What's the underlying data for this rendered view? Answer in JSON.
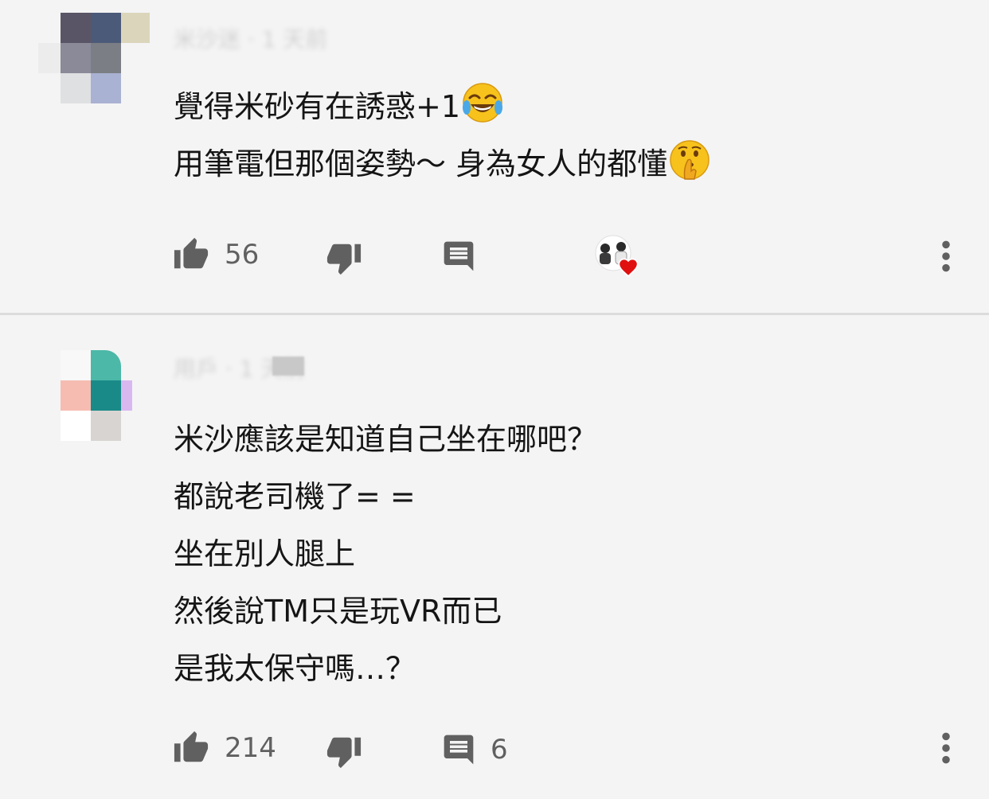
{
  "comments": [
    {
      "author_blurred": "米沙迷 · 1 天前",
      "lines": [
        "覺得米砂有在誘惑+1",
        "用筆電但那個姿勢～ 身為女人的都懂"
      ],
      "line_emojis": [
        "face-with-tears-of-joy-emoji",
        "shushing-face-emoji"
      ],
      "likes": "56",
      "replies": "",
      "hearted_by_creator": true,
      "avatar_colors": [
        "#5a5566",
        "#4c5a7a",
        "#c9bf94",
        "#8a8a99",
        "#7b7e84",
        "#dfe0e2",
        "#a9b2d2"
      ]
    },
    {
      "author_blurred": "用戶 · 1 天前",
      "lines": [
        "米沙應該是知道自己坐在哪吧？",
        "都說老司機了= =",
        "坐在別人腿上",
        "然後說TM只是玩VR而已",
        "是我太保守嗎…？"
      ],
      "likes": "214",
      "replies": "6",
      "hearted_by_creator": false,
      "avatar_colors": [
        "#f8f8f8",
        "#4cb8a8",
        "#f6bcb1",
        "#1a8a88",
        "#ffffff",
        "#d8d4d2",
        "#d9b8f0"
      ]
    }
  ],
  "icons": {
    "like": "thumb-up-icon",
    "dislike": "thumb-down-icon",
    "reply": "comment-icon",
    "more": "more-vert-icon",
    "heart": "heart-icon"
  },
  "colors": {
    "icon": "#606060",
    "heart": "#e01010",
    "background": "#f4f4f4",
    "divider": "#dcdcdc"
  }
}
